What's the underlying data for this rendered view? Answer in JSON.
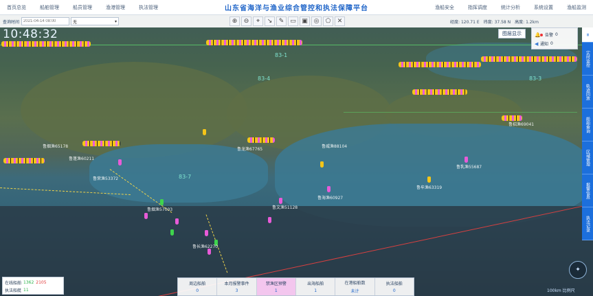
{
  "header": {
    "title": "山东省海洋与渔业综合管控和执法保障平台",
    "nav_left": [
      "首页总览",
      "船舶管理",
      "船员管理",
      "渔港管理",
      "执法管理"
    ],
    "nav_right": [
      "渔船安全",
      "指挥调度",
      "统计分析",
      "系统设置",
      "渔船监测"
    ]
  },
  "toolbar": {
    "time_label": "查询时间",
    "datetime_placeholder": "2021-04-14 08:00",
    "speed_value": "无",
    "tool_icons": [
      "zoom-in-icon",
      "zoom-out-icon",
      "locate-icon",
      "measure-icon",
      "draw-line-icon",
      "area-icon",
      "rectangle-icon",
      "circle-icon",
      "polygon-icon",
      "clear-icon"
    ],
    "tool_glyphs": [
      "⊕",
      "⊖",
      "⌖",
      "↘",
      "✎",
      "▭",
      "▣",
      "◎",
      "⬠",
      "✕"
    ],
    "status": [
      "经度: 120.71 E",
      "纬度: 37.58 N",
      "高度: 1.2km"
    ]
  },
  "clock": "10:48:32",
  "map": {
    "layers_button": "图层显示",
    "zones": [
      "83-1",
      "83-4",
      "83-3",
      "83-7"
    ],
    "vessel_labels": [
      "鲁烟渔65178",
      "鲁蓬渔60211",
      "鲁荣渔53372",
      "鲁龙渔67765",
      "鲁威渔88104",
      "鲁牟渔63319",
      "鲁乳渔55687",
      "鲁海渔60927",
      "鲁文渔51128",
      "鲁烟渔57003",
      "鲁长渔62270",
      "鲁招渔69041"
    ]
  },
  "alerts": {
    "items": [
      {
        "label": "告警",
        "count": "0"
      },
      {
        "label": "通知",
        "count": "0"
      }
    ]
  },
  "side_rail": [
    "≡",
    "实时监控",
    "轨迹回放",
    "船舶查询",
    "区域管理",
    "报警信息",
    "执法记录"
  ],
  "legend": {
    "row1_label": "在线船舶",
    "row1_online": "1362",
    "row1_offline": "2105",
    "row2_label": "执法船艇",
    "row2_value": "11"
  },
  "stats": [
    {
      "label": "周边船舶",
      "value": "0"
    },
    {
      "label": "本月报警事件",
      "value": "3"
    },
    {
      "label": "禁渔区预警",
      "value": "1"
    },
    {
      "label": "出海船舶",
      "value": "1"
    },
    {
      "label": "在港船舶数",
      "value": "未计"
    },
    {
      "label": "执法船舶",
      "value": "0"
    }
  ],
  "scale": "100km 比例尺"
}
